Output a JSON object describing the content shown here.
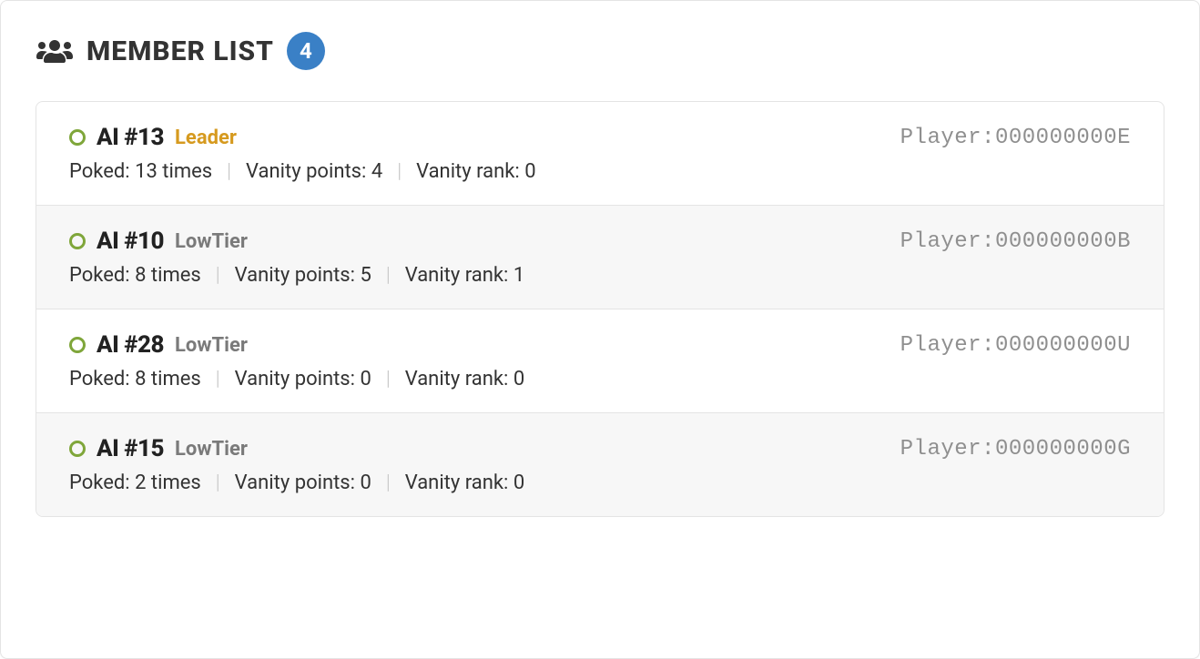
{
  "header": {
    "title": "MEMBER LIST",
    "count": "4"
  },
  "labels": {
    "player_prefix": "Player:",
    "stat_poked_prefix": "Poked: ",
    "stat_poked_suffix": " times",
    "stat_vanity_points_prefix": "Vanity points: ",
    "stat_vanity_rank_prefix": "Vanity rank: "
  },
  "members": [
    {
      "name": "AI #13",
      "role_label": "Leader",
      "role_kind": "leader",
      "player_id": "000000000E",
      "stats": {
        "poked": "13",
        "vanity_points": "4",
        "vanity_rank": "0"
      }
    },
    {
      "name": "AI #10",
      "role_label": "LowTier",
      "role_kind": "low",
      "player_id": "000000000B",
      "stats": {
        "poked": "8",
        "vanity_points": "5",
        "vanity_rank": "1"
      }
    },
    {
      "name": "AI #28",
      "role_label": "LowTier",
      "role_kind": "low",
      "player_id": "000000000U",
      "stats": {
        "poked": "8",
        "vanity_points": "0",
        "vanity_rank": "0"
      }
    },
    {
      "name": "AI #15",
      "role_label": "LowTier",
      "role_kind": "low",
      "player_id": "000000000G",
      "stats": {
        "poked": "2",
        "vanity_points": "0",
        "vanity_rank": "0"
      }
    }
  ]
}
